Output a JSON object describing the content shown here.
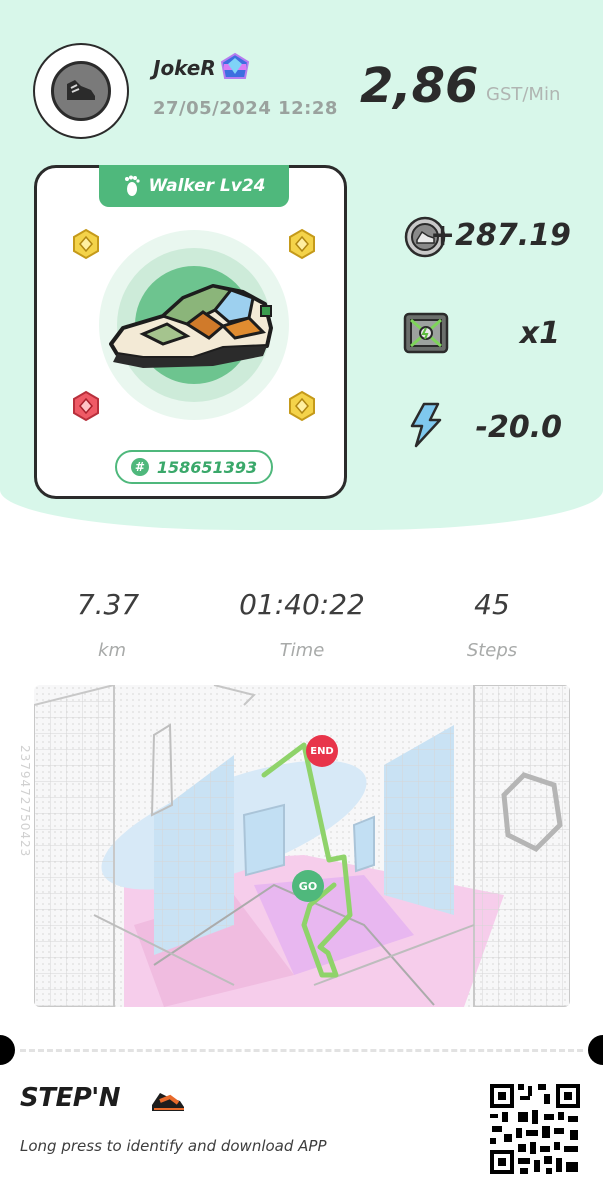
{
  "user": {
    "name": "JokeR",
    "datetime": "27/05/2024 12:28"
  },
  "earnings": {
    "rate": "2,86",
    "unit": "GST/Min"
  },
  "sneaker": {
    "level_label": "Walker Lv24",
    "id_label": "158651393"
  },
  "rewards": [
    {
      "icon": "gst-coin-icon",
      "value": "+287.19"
    },
    {
      "icon": "mystery-box-icon",
      "value": "x1"
    },
    {
      "icon": "energy-bolt-icon",
      "value": "-20.0"
    }
  ],
  "metrics": [
    {
      "value": "7.37",
      "label": "km"
    },
    {
      "value": "01:40:22",
      "label": "Time"
    },
    {
      "value": "45",
      "label": "Steps"
    }
  ],
  "map": {
    "end_label": "END",
    "start_label": "GO",
    "side_code": "2379472750423"
  },
  "footer": {
    "brand": "STEP'N",
    "text": "Long press to identify and download APP"
  },
  "colors": {
    "mint": "#d8f7ea",
    "accent": "#4fb87c",
    "route": "#8fd36a",
    "end_marker": "#e8344a",
    "start_marker": "#4fb87c"
  }
}
